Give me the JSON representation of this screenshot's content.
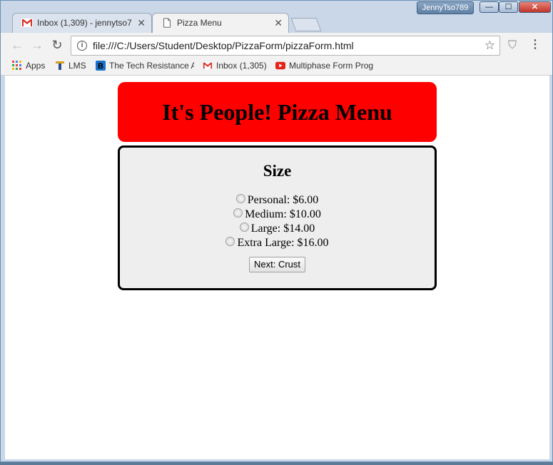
{
  "window": {
    "user": "JennyTso789",
    "controls": {
      "minimize": "—",
      "maximize": "☐",
      "close": "✕"
    }
  },
  "tabs": [
    {
      "title": "Inbox (1,309) - jennytso7",
      "icon": "gmail-icon",
      "active": false
    },
    {
      "title": "Pizza Menu",
      "icon": "page-icon",
      "active": true
    }
  ],
  "tab_close_glyph": "✕",
  "toolbar": {
    "url": "file:///C:/Users/Student/Desktop/PizzaForm/pizzaForm.html",
    "back": "←",
    "forward": "→",
    "reload": "↻",
    "star": "☆",
    "menu": "⋮",
    "info": "i",
    "shield": "⛉"
  },
  "bookmarks": [
    {
      "label": "Apps",
      "icon": "apps-grid-icon"
    },
    {
      "label": "LMS",
      "icon": "lms-icon"
    },
    {
      "label": "The Tech Resistance A",
      "icon": "tech-resistance-icon"
    },
    {
      "label": "Inbox (1,305)",
      "icon": "gmail-icon"
    },
    {
      "label": "Multiphase Form Prog",
      "icon": "youtube-icon"
    }
  ],
  "page": {
    "header": "It's People! Pizza Menu",
    "section_title": "Size",
    "options": [
      "Personal: $6.00",
      "Medium: $10.00",
      "Large: $14.00",
      "Extra Large: $16.00"
    ],
    "next_button": "Next: Crust"
  },
  "colors": {
    "header_bg": "#ff0000",
    "form_bg": "#eeeeee"
  }
}
